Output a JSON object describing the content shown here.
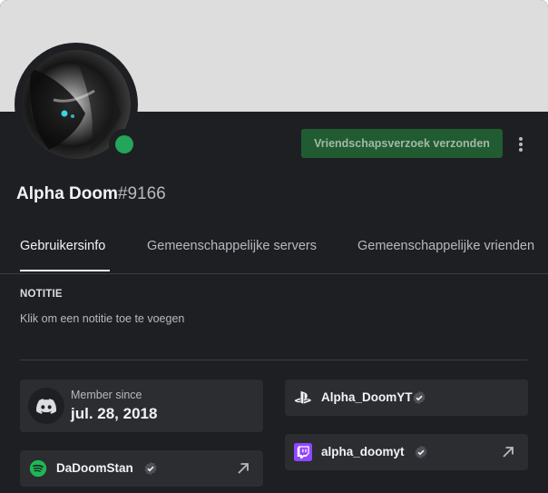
{
  "header": {
    "friend_button_label": "Vriendschapsverzoek verzonden",
    "more_icon": "more-vertical-icon",
    "status": "online",
    "status_color": "#23a55a"
  },
  "user": {
    "display_name": "Alpha Doom",
    "discriminator": "#9166"
  },
  "tabs": [
    {
      "label": "Gebruikersinfo",
      "active": true
    },
    {
      "label": "Gemeenschappelijke servers",
      "active": false
    },
    {
      "label": "Gemeenschappelijke vrienden",
      "active": false
    }
  ],
  "note": {
    "title": "NOTITIE",
    "placeholder": "Klik om een notitie toe te voegen"
  },
  "member_since": {
    "label": "Member since",
    "date": "jul. 28, 2018",
    "icon": "discord-icon"
  },
  "connections": [
    {
      "platform": "playstation",
      "icon": "playstation-icon",
      "name": "Alpha_DoomYT",
      "verified": true,
      "external_link": false
    },
    {
      "platform": "twitch",
      "icon": "twitch-icon",
      "name": "alpha_doomyt",
      "verified": true,
      "external_link": true,
      "color": "#9146ff"
    },
    {
      "platform": "spotify",
      "icon": "spotify-icon",
      "name": "DaDoomStan",
      "verified": true,
      "external_link": true,
      "color": "#1db954"
    }
  ],
  "colors": {
    "background": "#1e1f22",
    "banner": "#dcdddc",
    "card": "#2b2d31",
    "friend_button": "#215b32"
  }
}
